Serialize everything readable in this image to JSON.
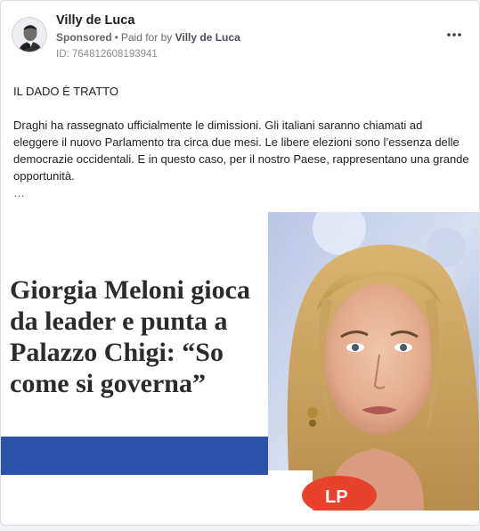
{
  "post": {
    "author": "Villy de Luca",
    "sponsored_label": "Sponsored",
    "dot": "•",
    "paid_for_prefix": "Paid for by",
    "payer": "Villy de Luca",
    "ad_id": "ID: 764812608193941",
    "more_icon": "more-horizontal-icon"
  },
  "content": {
    "title": "IL DADO È TRATTO",
    "body": "Draghi ha rassegnato ufficialmente le dimissioni. Gli italiani saranno chiamati ad eleggere il nuovo Parlamento tra circa due mesi. Le libere elezioni sono l’essenza delle democrazie occidentali. E in questo caso, per il nostro Paese, rappresentano una grande opportunità.",
    "ellipsis": "…"
  },
  "media": {
    "headline": "Giorgia Meloni gioca da leader e punta a Palazzo Chigi: “So come si governa”",
    "mic_label": "LP",
    "colors": {
      "band": "#2a52a8",
      "mic": "#e8412c"
    }
  }
}
